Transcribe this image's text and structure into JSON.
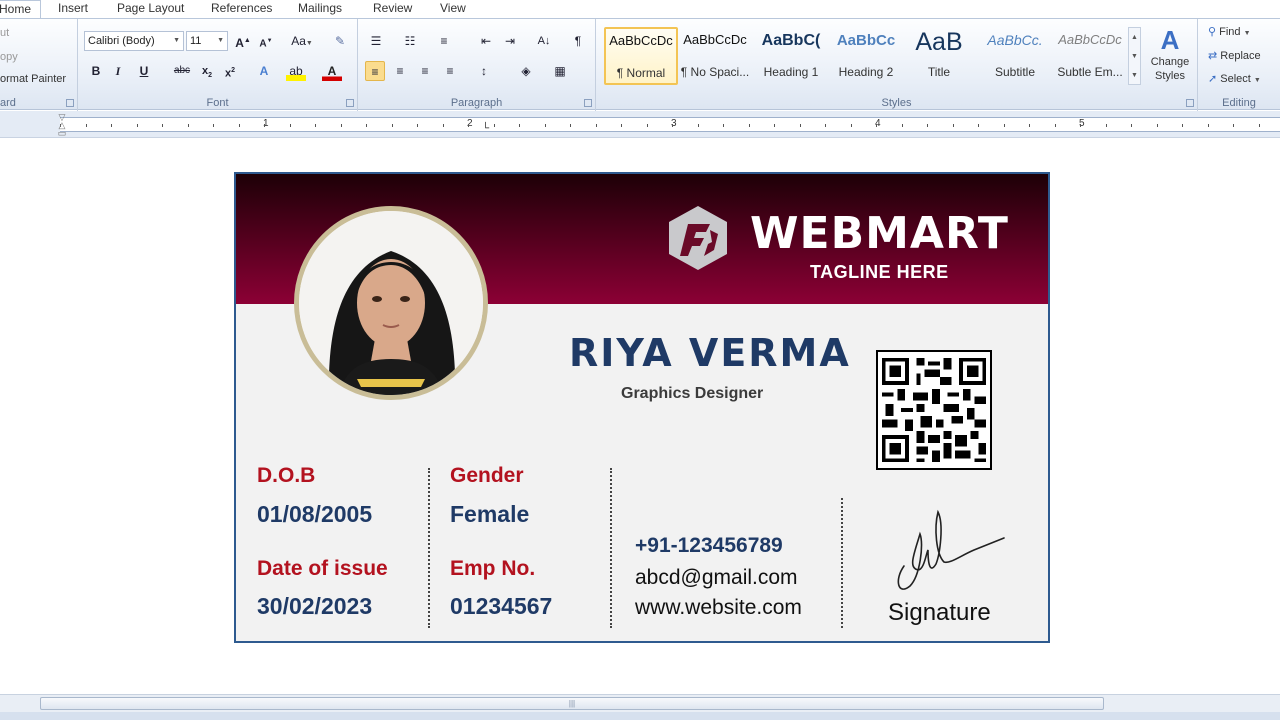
{
  "tabs": [
    "Home",
    "Insert",
    "Page Layout",
    "References",
    "Mailings",
    "Review",
    "View"
  ],
  "clipboard": {
    "cut": "ut",
    "copy": "opy",
    "format_painter": "ormat Painter",
    "label": "ard"
  },
  "font": {
    "family": "Calibri (Body)",
    "size": "11",
    "label": "Font"
  },
  "paragraph": {
    "label": "Paragraph"
  },
  "styles": {
    "label": "Styles",
    "items": [
      {
        "sample": "AaBbCcDc",
        "name": "¶ Normal"
      },
      {
        "sample": "AaBbCcDc",
        "name": "¶ No Spaci..."
      },
      {
        "sample": "AaBbC(",
        "name": "Heading 1"
      },
      {
        "sample": "AaBbCc",
        "name": "Heading 2"
      },
      {
        "sample": "AaB",
        "name": "Title"
      },
      {
        "sample": "AaBbCc.",
        "name": "Subtitle"
      },
      {
        "sample": "AaBbCcDc",
        "name": "Subtle Em..."
      }
    ],
    "change_styles": "Change Styles"
  },
  "editing": {
    "find": "Find",
    "replace": "Replace",
    "select": "Select",
    "label": "Editing"
  },
  "ruler": {
    "numbers": [
      "1",
      "2",
      "3",
      "4",
      "5"
    ]
  },
  "card": {
    "brand": "WEBMART",
    "tagline": "TAGLINE HERE",
    "name": "RIYA VERMA",
    "title": "Graphics Designer",
    "dob_label": "D.O.B",
    "dob": "01/08/2005",
    "gender_label": "Gender",
    "gender": "Female",
    "issue_label": "Date of issue",
    "issue": "30/02/2023",
    "emp_label": "Emp No.",
    "emp": "01234567",
    "phone": "+91-123456789",
    "email": "abcd@gmail.com",
    "website": "www.website.com",
    "signature_label": "Signature"
  },
  "colors": {
    "header_dark": "#1d0007",
    "header_light": "#8c0035",
    "label_red": "#b3121f",
    "value_navy": "#1f3a66",
    "card_border": "#2e5a8f"
  }
}
